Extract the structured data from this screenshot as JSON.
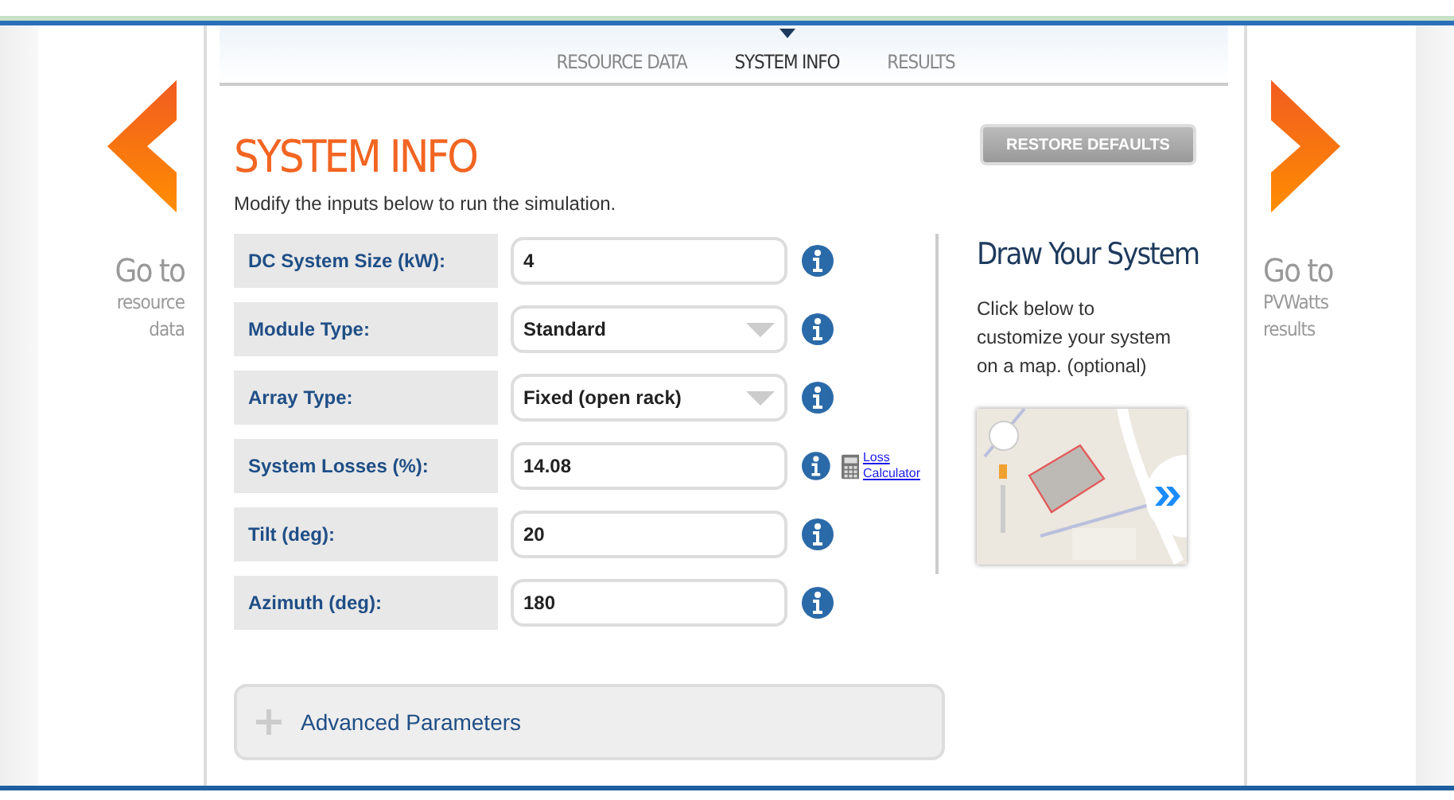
{
  "tabs": [
    {
      "label": "RESOURCE DATA",
      "selected": false
    },
    {
      "label": "SYSTEM INFO",
      "selected": true
    },
    {
      "label": "RESULTS",
      "selected": false
    }
  ],
  "prev": {
    "big": "Go to",
    "small": "resource data"
  },
  "next": {
    "big": "Go to",
    "small": "PVWatts results"
  },
  "title": "SYSTEM INFO",
  "intro": "Modify the inputs below to run the simulation.",
  "restore_button": "RESTORE DEFAULTS",
  "fields": [
    {
      "label": "DC System Size (kW):",
      "value": "4",
      "kind": "text"
    },
    {
      "label": "Module Type:",
      "value": "Standard",
      "kind": "select"
    },
    {
      "label": "Array Type:",
      "value": "Fixed (open rack)",
      "kind": "select"
    },
    {
      "label": "System Losses (%):",
      "value": "14.08",
      "kind": "text",
      "link": "Loss Calculator"
    },
    {
      "label": "Tilt (deg):",
      "value": "20",
      "kind": "text"
    },
    {
      "label": "Azimuth (deg):",
      "value": "180",
      "kind": "text"
    }
  ],
  "draw": {
    "title": "Draw Your System",
    "text": "Click below to customize your system on a map. (optional)"
  },
  "advanced": {
    "label": "Advanced Parameters",
    "expanded": false
  }
}
